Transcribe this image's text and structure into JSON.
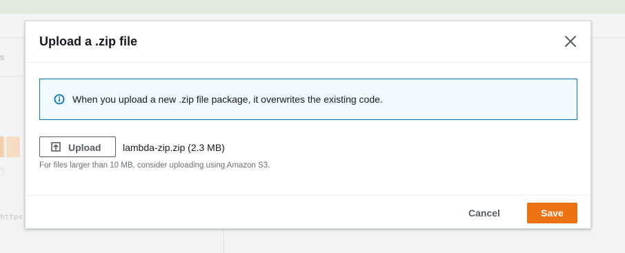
{
  "background": {
    "tab_fragment": "s",
    "url_fragment": "https:"
  },
  "modal": {
    "title": "Upload a .zip file",
    "info_message": "When you upload a new .zip file package, it overwrites the existing code.",
    "upload_button_label": "Upload",
    "selected_file": "lambda-zip.zip (2.3 MB)",
    "hint": "For files larger than 10 MB, consider uploading using Amazon S3.",
    "cancel_label": "Cancel",
    "save_label": "Save"
  },
  "colors": {
    "primary": "#ec7211",
    "info_border": "#0073bb",
    "info_background": "#f1faff"
  },
  "icons": {
    "close": "close-icon",
    "info": "info-icon",
    "upload": "upload-icon"
  }
}
